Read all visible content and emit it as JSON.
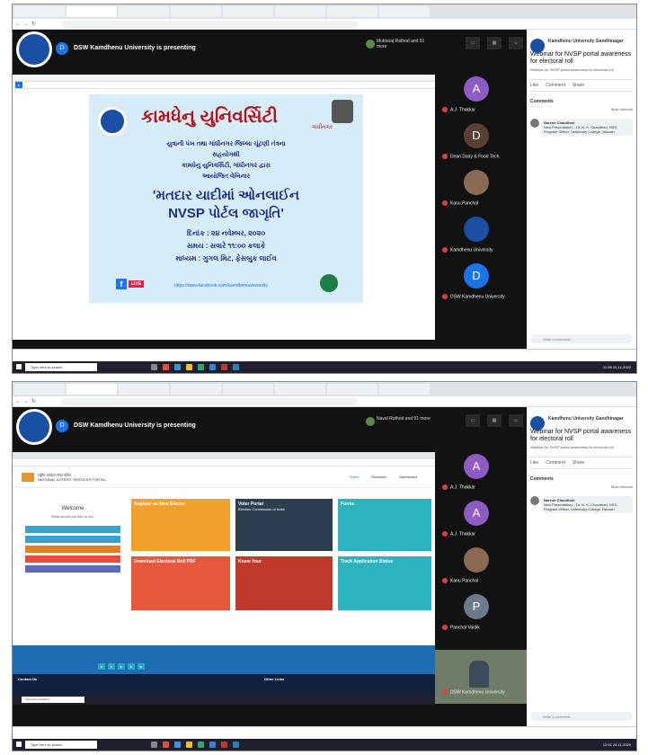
{
  "colors": {
    "meet_bg": "#121212",
    "accent_blue": "#1a73e8",
    "poster_red": "#b8121c",
    "poster_blue": "#1b2f8a",
    "poster_bg": "#d6ecf7"
  },
  "frames": [
    {
      "presenting_title": "DSW Kamdhenu University is presenting",
      "presenter_avatar": "D",
      "presenter": "Muktaraj Rathod and 91 more",
      "poster": {
        "title": "કામધેનુ યુનિવર્સિટી",
        "subtitle": "ગાંધીનગર",
        "line1": "યુવાની પંખ તથા ગાંધીનગર જિલ્લા ચૂંટણી તંત્રના",
        "line2": "સહયોગથી",
        "line3": "કામધેનુ યુનિવર્સિટી, ગાંધીનગર દ્વારા",
        "line4": "આયોજિત વેબિનાર",
        "heading1": "'મતદાર યાદીમાં ઓનલાઈન",
        "heading2": "NVSP પોર્ટલ જાગૃતિ'",
        "date": "દિનાંક : ૨૪ નવેમ્બર, ૨૦૨૦",
        "time": "સમય : સવારે ૧૧:૦૦ કલાકે",
        "medium": "માધ્યમ : ગુગલ મિટ, ફેસબુક લાઈવ",
        "live": "LIVE",
        "link": "https://www.facebook.com/kamdhenuuniversity"
      },
      "participants": [
        {
          "initial": "A",
          "name": "A.J. Thakkar",
          "color": "#8e5bc4"
        },
        {
          "initial": "D",
          "name": "Dean Dairy & Food Tech.",
          "color": "#5a4033"
        },
        {
          "initial": "",
          "name": "Kanu Panchal",
          "color": "#8a6a54"
        },
        {
          "initial": "",
          "name": "Kamdhenu University",
          "color": "#1a4fa3"
        },
        {
          "initial": "D",
          "name": "DSW Kamdhenu University",
          "color": "#1a73e8"
        }
      ],
      "fb": {
        "page": "Kamdhenu University Gandhinagar",
        "post_title": "Webinar for NVSP portal awareness for electoral roll",
        "post_sub": "Webinar for NVSP portal awareness for electoral roll",
        "like": "Like",
        "comment": "Comment",
        "share": "Share",
        "comments": "Comments",
        "relevant": "Most relevant",
        "commenter": "Naresh Chaudhari",
        "comment_text": "New Presentation... Dr. N. K. Chaudhari, NSS Program Officer, Veterinary College, Navsari",
        "write": "Write a comment..."
      },
      "taskbar_search": "Type here to search",
      "clock": "11:58 24-11-2020"
    },
    {
      "presenting_title": "DSW Kamdhenu University is presenting",
      "presenter_avatar": "D",
      "presenter": "Naval Rathod and 91 more",
      "nvsp": {
        "portal_title": "राष्ट्रीय मतदाता सेवा पोर्टल",
        "portal_sub": "NATIONAL VOTERS' SERVICES PORTAL",
        "menu": [
          "Home",
          "Research",
          "Dashboard"
        ],
        "welcome": "Welcome",
        "welcome_sub": "What would you like to do?",
        "tile_register": "Register as New Elector",
        "tile_voter": "Voter Portal",
        "tile_voter_sub": "Election Commission of India",
        "tile_forms": "Forms",
        "tile_download": "Download Electoral Roll PDF",
        "tile_know": "Know Your",
        "tile_track": "Track Application Status",
        "footer_contact": "Contact Us",
        "footer_links": "Other Links"
      },
      "participants": [
        {
          "initial": "A",
          "name": "A.J. Thakkar",
          "color": "#8e5bc4"
        },
        {
          "initial": "A",
          "name": "A.J. Thakkar",
          "color": "#8e5bc4"
        },
        {
          "initial": "",
          "name": "Kanu Panchal",
          "color": "#8a6a54"
        },
        {
          "initial": "P",
          "name": "Panchal Vaidik",
          "color": "#6b7b8c"
        }
      ],
      "cam_name": "DSW Kamdhenu University",
      "fb": {
        "page": "Kamdhenu University Gandhinagar",
        "post_title": "Webinar for NVSP portal awareness for electoral roll",
        "post_sub": "Webinar for NVSP portal awareness for electoral roll",
        "like": "Like",
        "comment": "Comment",
        "share": "Share",
        "comments": "Comments",
        "relevant": "Most relevant",
        "commenter": "Naresh Chaudhari",
        "comment_text": "New Presentation... Dr. N. K. Chaudhari, NSS Program Officer, Veterinary College, Navsari",
        "write": "Write a comment..."
      },
      "taskbar_search": "Type here to search",
      "clock": "12:01 24-11-2020"
    }
  ]
}
